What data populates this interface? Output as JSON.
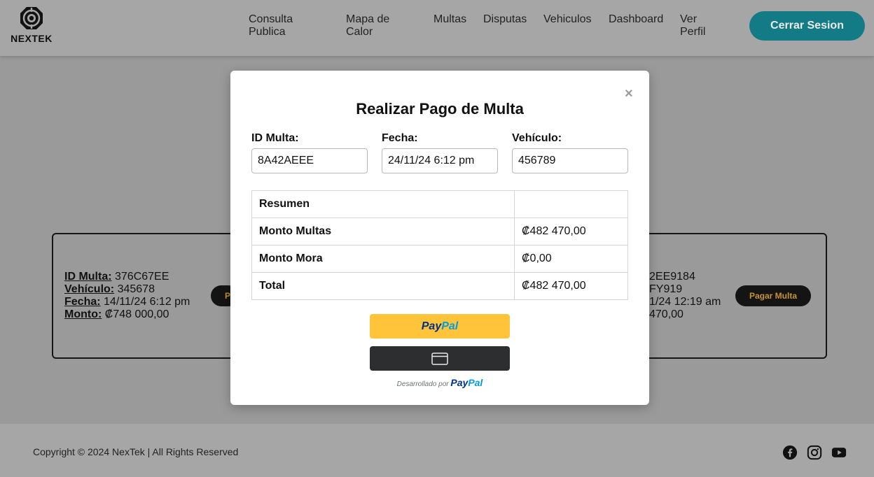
{
  "header": {
    "logo_text": "NEXTEK",
    "nav": [
      {
        "line1": "Consulta",
        "line2": "Publica"
      },
      {
        "line1": "Mapa de",
        "line2": "Calor"
      },
      {
        "line1": "Multas",
        "line2": ""
      },
      {
        "line1": "Disputas",
        "line2": ""
      },
      {
        "line1": "Vehiculos",
        "line2": ""
      },
      {
        "line1": "Dashboard",
        "line2": ""
      },
      {
        "line1": "Ver",
        "line2": "Perfil"
      }
    ],
    "logout_label": "Cerrar Sesion"
  },
  "cards": [
    {
      "id_label": "ID Multa:",
      "id_value": "376C67EE",
      "vehicle_label": "Vehículo:",
      "vehicle_value": "345678",
      "date_label": "Fecha:",
      "date_value": "14/11/24 6:12 pm",
      "amount_label": "Monto:",
      "amount_value": "₡748 000,00",
      "pay_label": "P"
    },
    {
      "id_value": "2EE9184",
      "vehicle_value": "FY919",
      "date_value": "1/24 12:19 am",
      "amount_value": "470,00",
      "pay_label": "Pagar Multa"
    }
  ],
  "modal": {
    "close": "×",
    "title": "Realizar Pago de Multa",
    "fields": [
      {
        "label": "ID Multa:",
        "value": "8A42AEEE"
      },
      {
        "label": "Fecha:",
        "value": "24/11/24 6:12 pm"
      },
      {
        "label": "Vehículo:",
        "value": "456789"
      }
    ],
    "summary": [
      {
        "label": "Resumen",
        "value": ""
      },
      {
        "label": "Monto Multas",
        "value": "₡482 470,00"
      },
      {
        "label": "Monto Mora",
        "value": "₡0,00"
      },
      {
        "label": "Total",
        "value": "₡482 470,00"
      }
    ],
    "paypal_pay": "Pay",
    "paypal_pal": "Pal",
    "powered_by": "Desarrollado por",
    "powered_pay": "Pay",
    "powered_pal": "Pal"
  },
  "footer": {
    "copyright": "Copyright © 2024 NexTek | All Rights Reserved",
    "social": [
      "facebook-icon",
      "instagram-icon",
      "youtube-icon"
    ]
  },
  "colors": {
    "accent": "#137b86",
    "paypal_yellow": "#ffc439",
    "paypal_dark_blue": "#003087",
    "paypal_light_blue": "#009cde",
    "card_button": "#2c2e2f"
  }
}
